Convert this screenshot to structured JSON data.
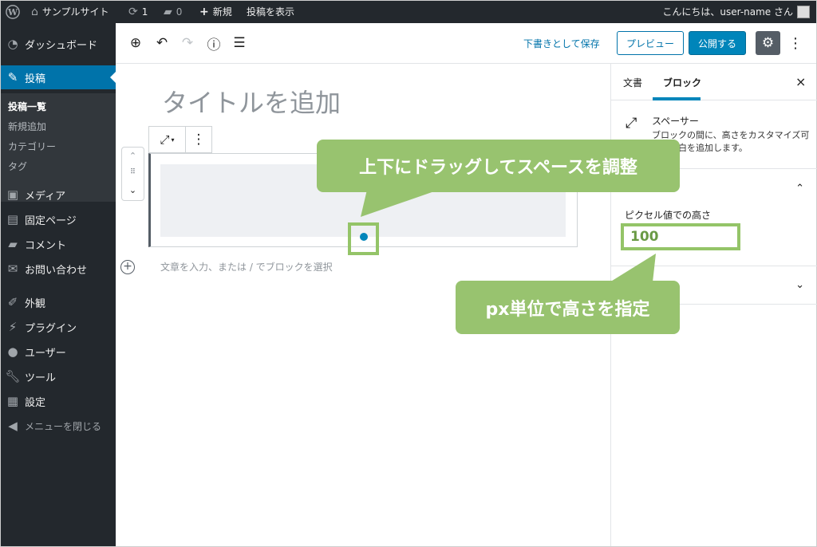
{
  "admin_bar": {
    "site_name": "サンプルサイト",
    "updates_count": "1",
    "comments_count": "0",
    "new_label": "新規",
    "view_post_label": "投稿を表示",
    "greeting": "こんにちは、user-name さん"
  },
  "admin_menu": {
    "items": [
      {
        "label": "ダッシュボード",
        "icon": "dashboard-icon"
      },
      {
        "label": "投稿",
        "icon": "pin-icon"
      },
      {
        "label": "メディア",
        "icon": "media-icon"
      },
      {
        "label": "固定ページ",
        "icon": "page-icon"
      },
      {
        "label": "コメント",
        "icon": "comment-icon"
      },
      {
        "label": "お問い合わせ",
        "icon": "mail-icon"
      },
      {
        "label": "外観",
        "icon": "brush-icon"
      },
      {
        "label": "プラグイン",
        "icon": "plugin-icon"
      },
      {
        "label": "ユーザー",
        "icon": "user-icon"
      },
      {
        "label": "ツール",
        "icon": "wrench-icon"
      },
      {
        "label": "設定",
        "icon": "settings-icon"
      },
      {
        "label": "メニューを閉じる",
        "icon": "collapse-icon"
      }
    ],
    "submenu": [
      "投稿一覧",
      "新規追加",
      "カテゴリー",
      "タグ"
    ]
  },
  "toolbar": {
    "save_draft": "下書きとして保存",
    "preview": "プレビュー",
    "publish": "公開する"
  },
  "editor": {
    "title_placeholder": "タイトルを追加",
    "appender_placeholder": "文章を入力、または / でブロックを選択"
  },
  "panel": {
    "tab_document": "文書",
    "tab_block": "ブロック",
    "close": "×",
    "block_name": "スペーサー",
    "block_description": "ブロックの間に、高さをカスタマイズ可能な余白を追加します。",
    "height_label": "ピクセル値での高さ",
    "height_value": "100"
  },
  "callouts": {
    "drag": "上下にドラッグしてスペースを調整",
    "px": "px単位で高さを指定"
  },
  "colors": {
    "admin_dark": "#23282d",
    "admin_blue": "#0073aa",
    "callout_green": "#98c36f"
  }
}
